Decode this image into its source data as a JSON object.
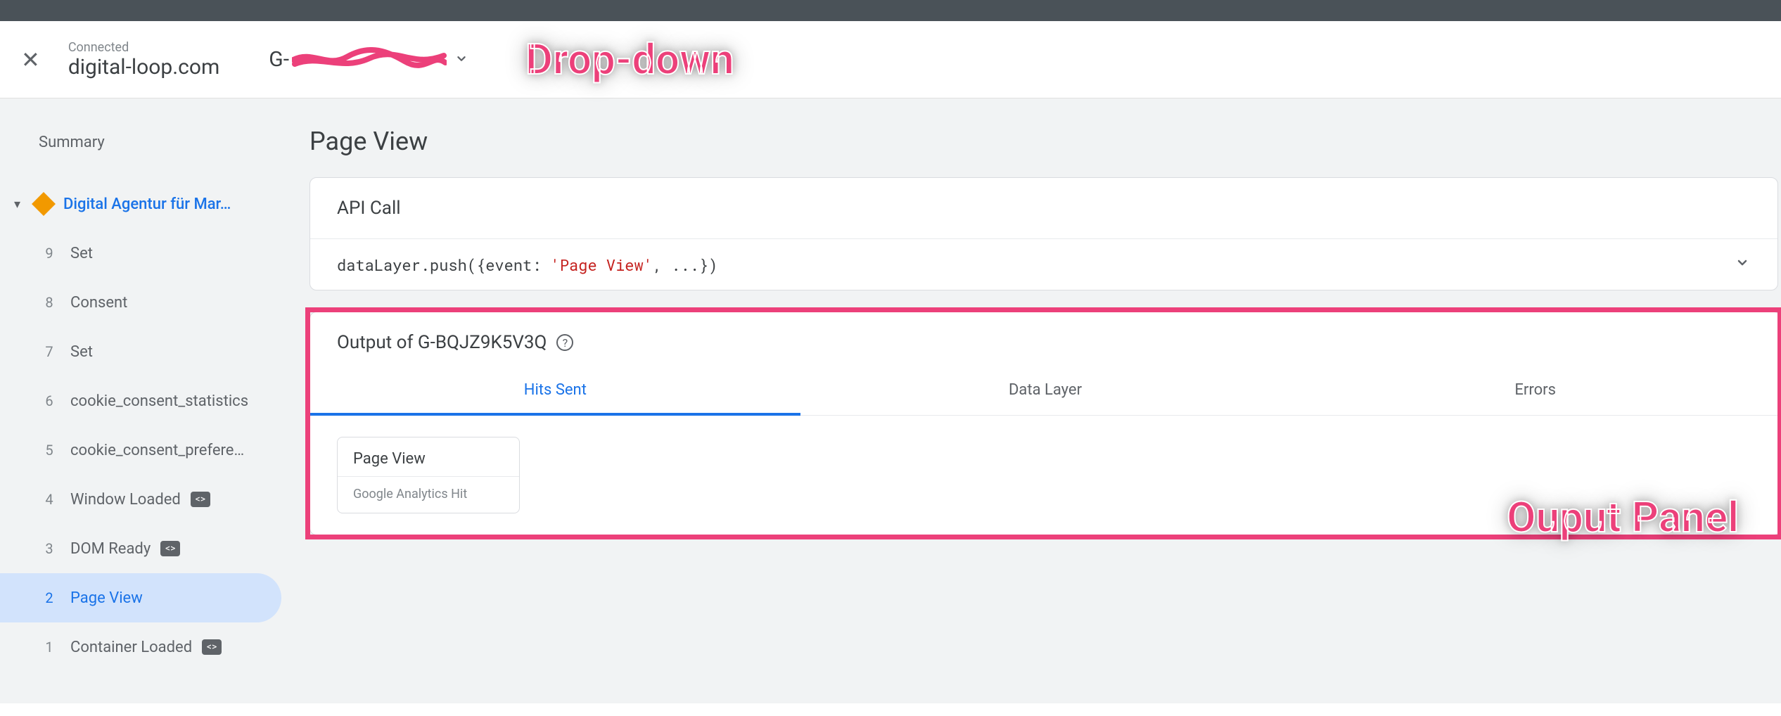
{
  "header": {
    "connected_label": "Connected",
    "domain": "digital-loop.com",
    "gid_prefix": "G-"
  },
  "annotations": {
    "dropdown": "Drop-down",
    "output_panel": "Ouput Panel"
  },
  "sidebar": {
    "summary": "Summary",
    "first_item": "Digital Agentur für Mar…",
    "items": [
      {
        "num": "9",
        "label": "Set",
        "badge": false
      },
      {
        "num": "8",
        "label": "Consent",
        "badge": false
      },
      {
        "num": "7",
        "label": "Set",
        "badge": false
      },
      {
        "num": "6",
        "label": "cookie_consent_statistics",
        "badge": false
      },
      {
        "num": "5",
        "label": "cookie_consent_prefere…",
        "badge": false
      },
      {
        "num": "4",
        "label": "Window Loaded",
        "badge": true
      },
      {
        "num": "3",
        "label": "DOM Ready",
        "badge": true
      },
      {
        "num": "2",
        "label": "Page View",
        "badge": false,
        "active": true
      },
      {
        "num": "1",
        "label": "Container Loaded",
        "badge": true
      }
    ]
  },
  "main": {
    "title": "Page View",
    "api_card": {
      "heading": "API Call",
      "code_pre": "dataLayer.push({event: ",
      "code_str": "'Page View'",
      "code_post": ", ...})"
    },
    "output": {
      "heading": "Output of G-BQJZ9K5V3Q",
      "tabs": {
        "hits": "Hits Sent",
        "data_layer": "Data Layer",
        "errors": "Errors"
      },
      "hit": {
        "title": "Page View",
        "subtitle": "Google Analytics Hit"
      }
    }
  }
}
